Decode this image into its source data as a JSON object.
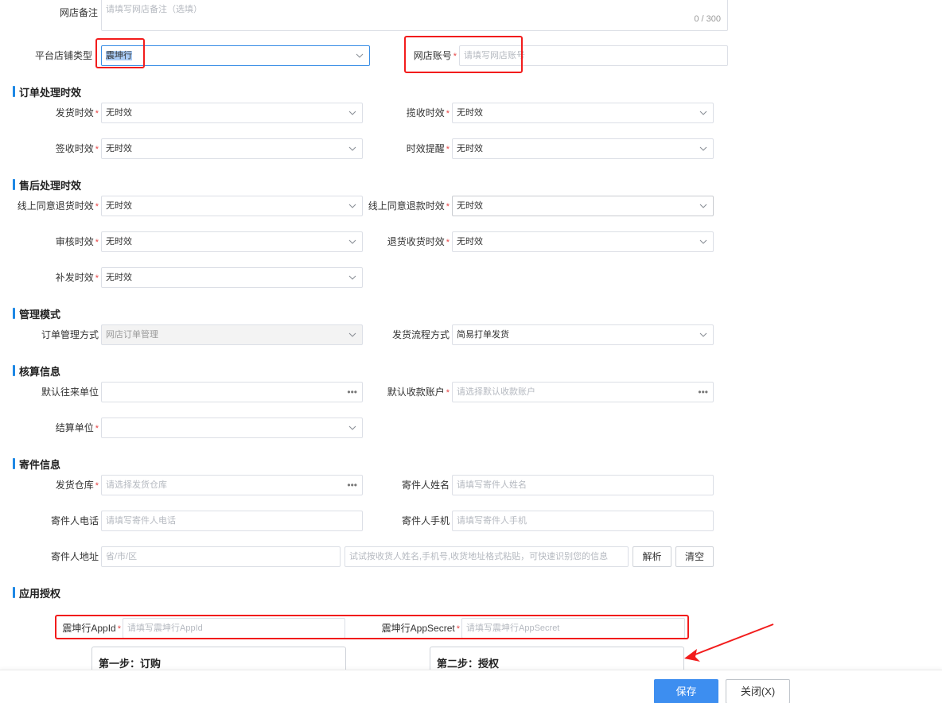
{
  "remark": {
    "label": "网店备注",
    "placeholder": "请填写网店备注（选填）",
    "counter": "0 / 300"
  },
  "platform": {
    "shop_type_label": "平台店铺类型",
    "shop_type_value": "震坤行",
    "account_label": "网店账号",
    "account_placeholder": "请填写网店账号"
  },
  "sections": {
    "order_timing": "订单处理时效",
    "aftersale_timing": "售后处理时效",
    "manage_mode": "管理模式",
    "accounting": "核算信息",
    "sender": "寄件信息",
    "app_auth": "应用授权"
  },
  "order_timing": {
    "ship_label": "发货时效",
    "ship_value": "无时效",
    "pickup_label": "揽收时效",
    "pickup_value": "无时效",
    "sign_label": "签收时效",
    "sign_value": "无时效",
    "remind_label": "时效提醒",
    "remind_value": "无时效"
  },
  "aftersale_timing": {
    "return_goods_label": "线上同意退货时效",
    "return_goods_value": "无时效",
    "refund_label": "线上同意退款时效",
    "refund_value": "无时效",
    "audit_label": "审核时效",
    "audit_value": "无时效",
    "return_receive_label": "退货收货时效",
    "return_receive_value": "无时效",
    "reissue_label": "补发时效",
    "reissue_value": "无时效"
  },
  "manage_mode": {
    "order_manage_label": "订单管理方式",
    "order_manage_value": "网店订单管理",
    "ship_flow_label": "发货流程方式",
    "ship_flow_value": "简易打单发货"
  },
  "accounting": {
    "default_partner_label": "默认往来单位",
    "default_account_label": "默认收款账户",
    "default_account_placeholder": "请选择默认收款账户",
    "settle_unit_label": "结算单位"
  },
  "sender": {
    "warehouse_label": "发货仓库",
    "warehouse_placeholder": "请选择发货仓库",
    "name_label": "寄件人姓名",
    "name_placeholder": "请填写寄件人姓名",
    "phone_label": "寄件人电话",
    "phone_placeholder": "请填写寄件人电话",
    "mobile_label": "寄件人手机",
    "mobile_placeholder": "请填写寄件人手机",
    "address_label": "寄件人地址",
    "region_placeholder": "省/市/区",
    "paste_placeholder": "试试按收货人姓名,手机号,收货地址格式粘贴，可快速识别您的信息",
    "parse_button": "解析",
    "clear_button": "清空"
  },
  "app_auth": {
    "appid_label": "震坤行AppId",
    "appid_placeholder": "请填写震坤行AppId",
    "secret_label": "震坤行AppSecret",
    "secret_placeholder": "请填写震坤行AppSecret",
    "step1_title": "第一步：订购",
    "step2_title": "第二步：授权"
  },
  "footer": {
    "save": "保存",
    "close": "关闭(X)"
  },
  "colors": {
    "accent": "#3d8ef0",
    "section_bar": "#1e88e5",
    "required": "#e64545",
    "annotation": "#f21c1c"
  }
}
